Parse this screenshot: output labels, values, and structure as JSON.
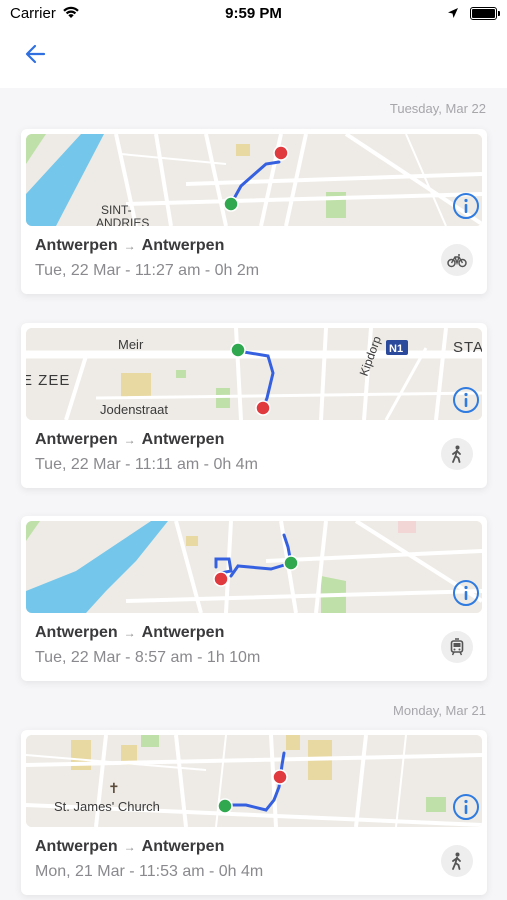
{
  "status_bar": {
    "carrier": "Carrier",
    "time": "9:59 PM"
  },
  "nav": {
    "back_icon": "arrow-left-icon",
    "accent_color": "#2f6fe0"
  },
  "sections": [
    {
      "date": "Tuesday, Mar 22"
    },
    {
      "date": "Monday, Mar 21"
    }
  ],
  "trips": [
    {
      "from": "Antwerpen",
      "to": "Antwerpen",
      "meta": "Tue, 22 Mar - 11:27 am - 0h 2m",
      "mode_icon": "bicycle-icon",
      "map_labels": [
        "SINT-",
        "ANDRIES"
      ]
    },
    {
      "from": "Antwerpen",
      "to": "Antwerpen",
      "meta": "Tue, 22 Mar - 11:11 am - 0h 4m",
      "mode_icon": "walking-icon",
      "map_labels": [
        "Meir",
        "E ZEE",
        "Jodenstraat",
        "Kipdorp",
        "N1",
        "STA"
      ]
    },
    {
      "from": "Antwerpen",
      "to": "Antwerpen",
      "meta": "Tue, 22 Mar - 8:57 am - 1h 10m",
      "mode_icon": "tram-icon",
      "map_labels": []
    },
    {
      "from": "Antwerpen",
      "to": "Antwerpen",
      "meta": "Mon, 21 Mar - 11:53 am - 0h 4m",
      "mode_icon": "walking-icon",
      "map_labels": [
        "St. James' Church"
      ]
    }
  ],
  "colors": {
    "route": "#3560e0",
    "start_marker": "#2fa84f",
    "end_marker": "#e0393e",
    "info": "#2f7be0",
    "water": "#74c6ea",
    "park": "#bfe0a8"
  }
}
